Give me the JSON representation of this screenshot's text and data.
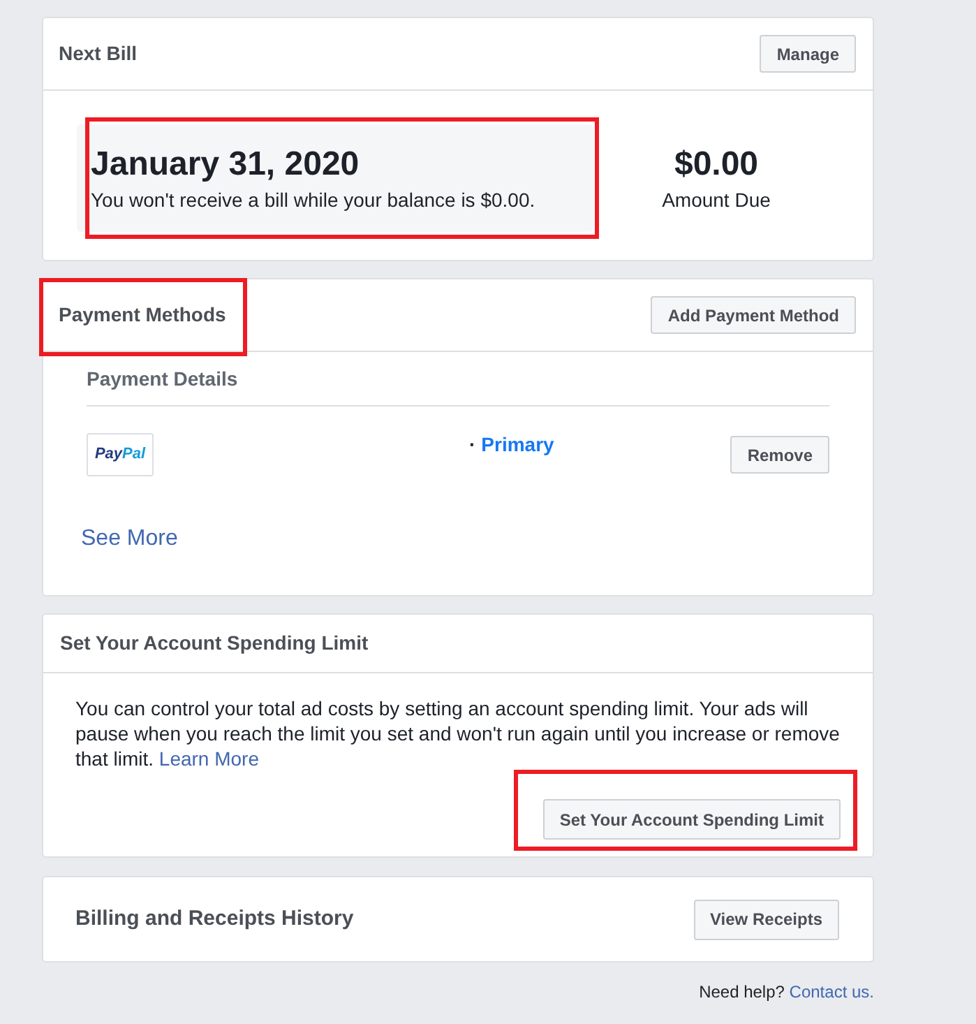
{
  "next_bill": {
    "title": "Next Bill",
    "button": "Manage",
    "date": "January 31, 2020",
    "note": "You won't receive a bill while your balance is $0.00.",
    "highlighted": true,
    "amount": "$0.00",
    "amount_label": "Amount Due"
  },
  "payment_methods": {
    "title": "Payment Methods",
    "highlighted": true,
    "button": "Add Payment Method",
    "details_heading": "Payment Details",
    "methods": [
      {
        "logo": [
          "Pay",
          "Pal"
        ],
        "separator": "·",
        "status": "Primary",
        "button": "Remove"
      }
    ],
    "see_more": "See More"
  },
  "spending_limit": {
    "title": "Set Your Account Spending Limit",
    "text": "You can control your total ad costs by setting an account spending limit. Your ads will pause when you reach the limit you set and won't run again until you increase or remove that limit.",
    "link": "Learn More",
    "button": "Set Your Account Spending Limit",
    "highlighted": true
  },
  "billing_history": {
    "title": "Billing and Receipts History",
    "button": "View Receipts"
  },
  "footer": {
    "text": "Need help?",
    "link": "Contact us."
  }
}
